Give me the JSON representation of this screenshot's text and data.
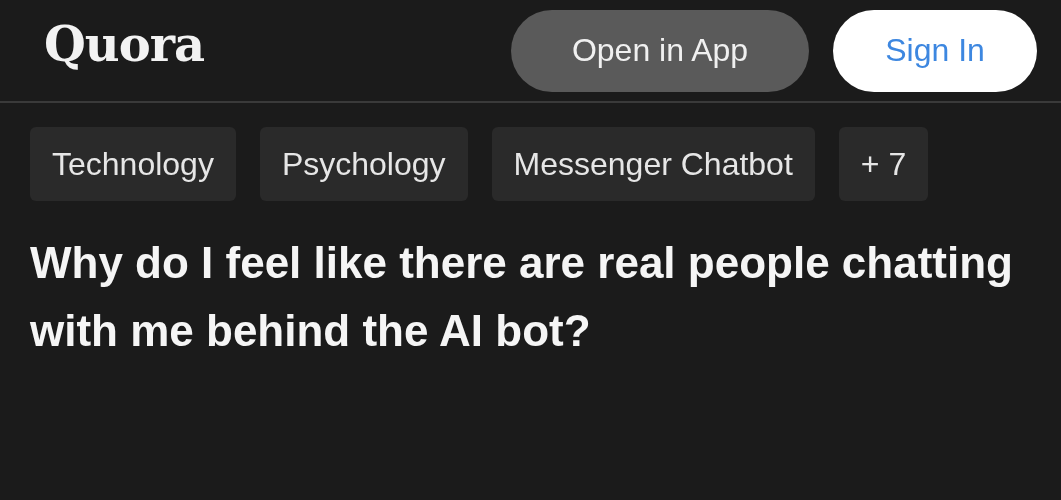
{
  "header": {
    "logo": "Quora",
    "buttons": [
      {
        "label": "Open in App",
        "kind": "secondary"
      },
      {
        "label": "Sign In",
        "kind": "primary"
      }
    ]
  },
  "topics": [
    {
      "label": "Technology"
    },
    {
      "label": "Psychology"
    },
    {
      "label": "Messenger Chatbot"
    },
    {
      "label": "+ 7"
    }
  ],
  "question": {
    "title": "Why do I feel like there are real people chatting with me behind the AI bot?"
  }
}
